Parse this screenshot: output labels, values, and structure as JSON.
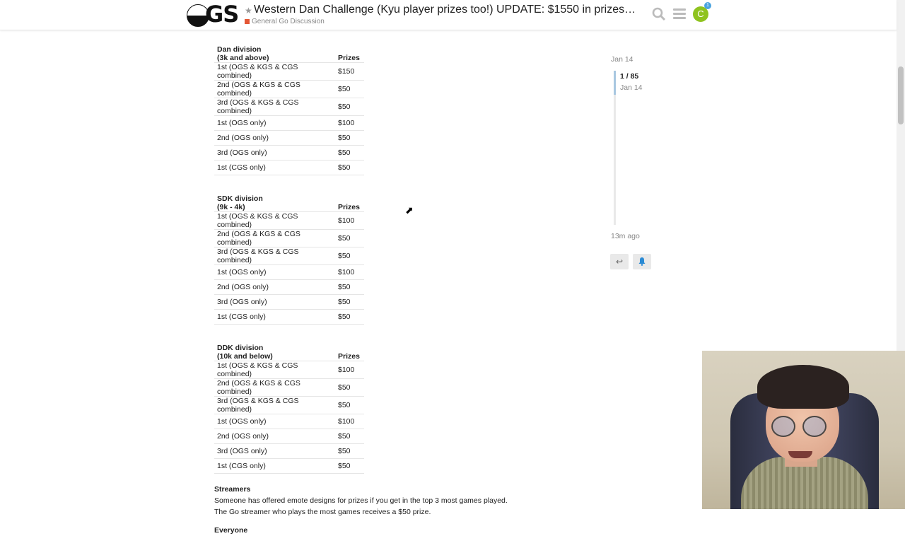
{
  "header": {
    "logo_text": "GS",
    "title": "Western Dan Challenge (Kyu player prizes too!) UPDATE: $1550 in prizes…",
    "category": "General Go Discussion",
    "avatar_letter": "C",
    "notification_count": "1",
    "category_color": "#e45735",
    "avatar_color": "#8fc31f"
  },
  "divisions": [
    {
      "name": "Dan division",
      "range": "(3k and above)",
      "prizes_header": "Prizes",
      "rows": [
        [
          "1st (OGS & KGS & CGS combined)",
          "$150"
        ],
        [
          "2nd (OGS & KGS & CGS combined)",
          "$50"
        ],
        [
          "3rd (OGS & KGS & CGS combined)",
          "$50"
        ],
        [
          "1st (OGS only)",
          "$100"
        ],
        [
          "2nd (OGS only)",
          "$50"
        ],
        [
          "3rd (OGS only)",
          "$50"
        ],
        [
          "1st (CGS only)",
          "$50"
        ]
      ]
    },
    {
      "name": "SDK division",
      "range": "(9k - 4k)",
      "prizes_header": "Prizes",
      "rows": [
        [
          "1st (OGS & KGS & CGS combined)",
          "$100"
        ],
        [
          "2nd (OGS & KGS & CGS combined)",
          "$50"
        ],
        [
          "3rd (OGS & KGS & CGS combined)",
          "$50"
        ],
        [
          "1st (OGS only)",
          "$100"
        ],
        [
          "2nd (OGS only)",
          "$50"
        ],
        [
          "3rd (OGS only)",
          "$50"
        ],
        [
          "1st (CGS only)",
          "$50"
        ]
      ]
    },
    {
      "name": "DDK division",
      "range": "(10k and below)",
      "prizes_header": "Prizes",
      "rows": [
        [
          "1st (OGS & KGS & CGS combined)",
          "$100"
        ],
        [
          "2nd (OGS & KGS & CGS combined)",
          "$50"
        ],
        [
          "3rd (OGS & KGS & CGS combined)",
          "$50"
        ],
        [
          "1st (OGS only)",
          "$100"
        ],
        [
          "2nd (OGS only)",
          "$50"
        ],
        [
          "3rd (OGS only)",
          "$50"
        ],
        [
          "1st (CGS only)",
          "$50"
        ]
      ]
    }
  ],
  "streamers": {
    "heading": "Streamers",
    "line1": "Someone has offered emote designs for prizes if you get in the top 3 most games played.",
    "line2": "The Go streamer who plays the most games receives a $50 prize."
  },
  "everyone": {
    "heading": "Everyone"
  },
  "timeline": {
    "top_date": "Jan 14",
    "position": "1 / 85",
    "position_date": "Jan 14",
    "last_activity": "13m ago"
  },
  "icons": {
    "reply": "reply-icon",
    "bell": "bell-icon",
    "search": "search-icon",
    "menu": "hamburger-menu-icon"
  }
}
